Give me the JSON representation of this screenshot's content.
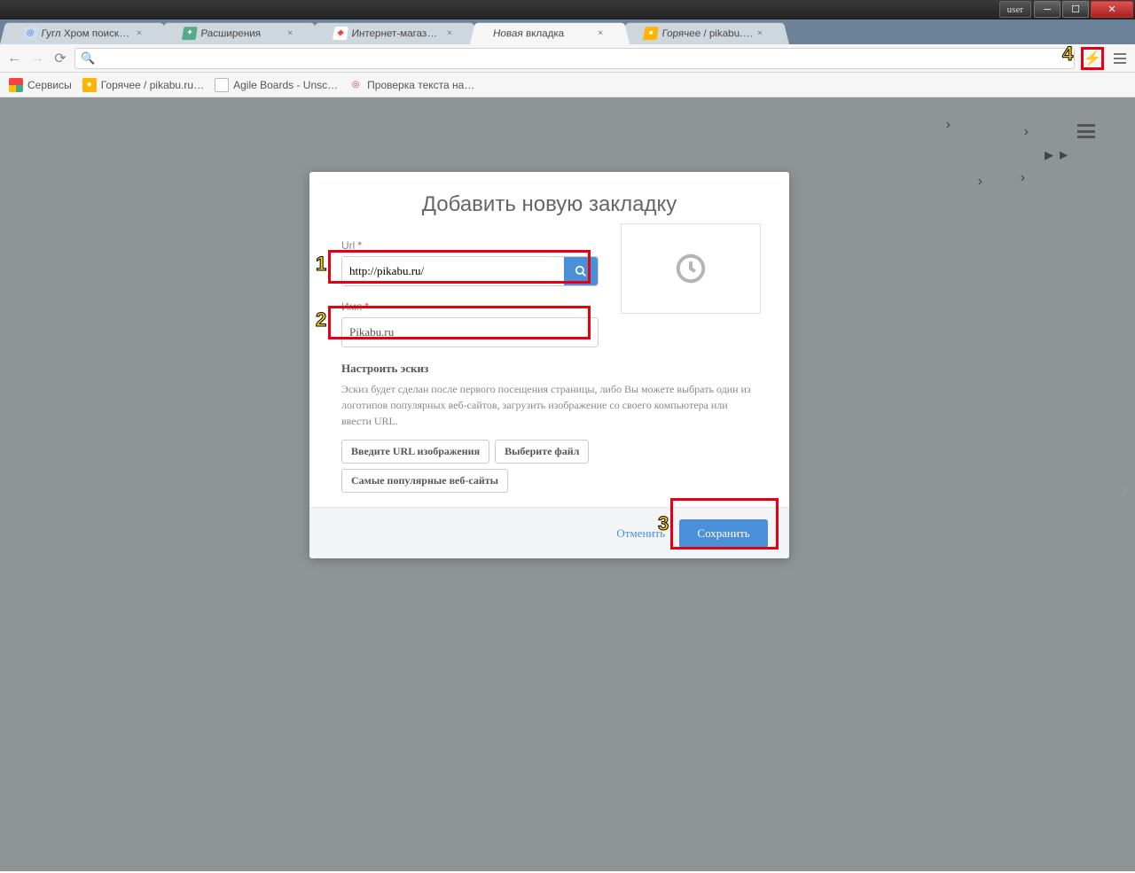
{
  "window": {
    "user_label": "user"
  },
  "tabs": [
    {
      "title": "Гугл Хром поисковая сис",
      "active": false,
      "fav": "◎"
    },
    {
      "title": "Расширения",
      "active": false,
      "fav": "✦"
    },
    {
      "title": "Интернет-магазин Chrom",
      "active": false,
      "fav": "◆"
    },
    {
      "title": "Новая вкладка",
      "active": true,
      "fav": ""
    },
    {
      "title": "Горячее / pikabu.ru - Все",
      "active": false,
      "fav": "●"
    }
  ],
  "bookmarks": [
    {
      "label": "Сервисы",
      "fav": "apps"
    },
    {
      "label": "Горячее / pikabu.ru…",
      "fav": "●"
    },
    {
      "label": "Agile Boards - Unsc…",
      "fav": "▫"
    },
    {
      "label": "Проверка текста на…",
      "fav": "◎"
    }
  ],
  "dialog": {
    "title": "Добавить новую закладку",
    "url_label": "Url",
    "url_value": "http://pikabu.ru/",
    "name_label": "Имя",
    "name_value": "Pikabu.ru",
    "thumb_heading": "Настроить эскиз",
    "thumb_text": "Эскиз будет сделан после первого посещения страницы, либо Вы можете выбрать один из логотипов популярных веб-сайтов, загрузить изображение со своего компьютера или ввести URL.",
    "btn_image_url": "Введите URL изображения",
    "btn_choose_file": "Выберите файл",
    "btn_popular": "Самые популярные веб-сайты",
    "cancel": "Отменить",
    "save": "Сохранить"
  },
  "annotations": {
    "n1": "1",
    "n2": "2",
    "n3": "3",
    "n4": "4"
  }
}
